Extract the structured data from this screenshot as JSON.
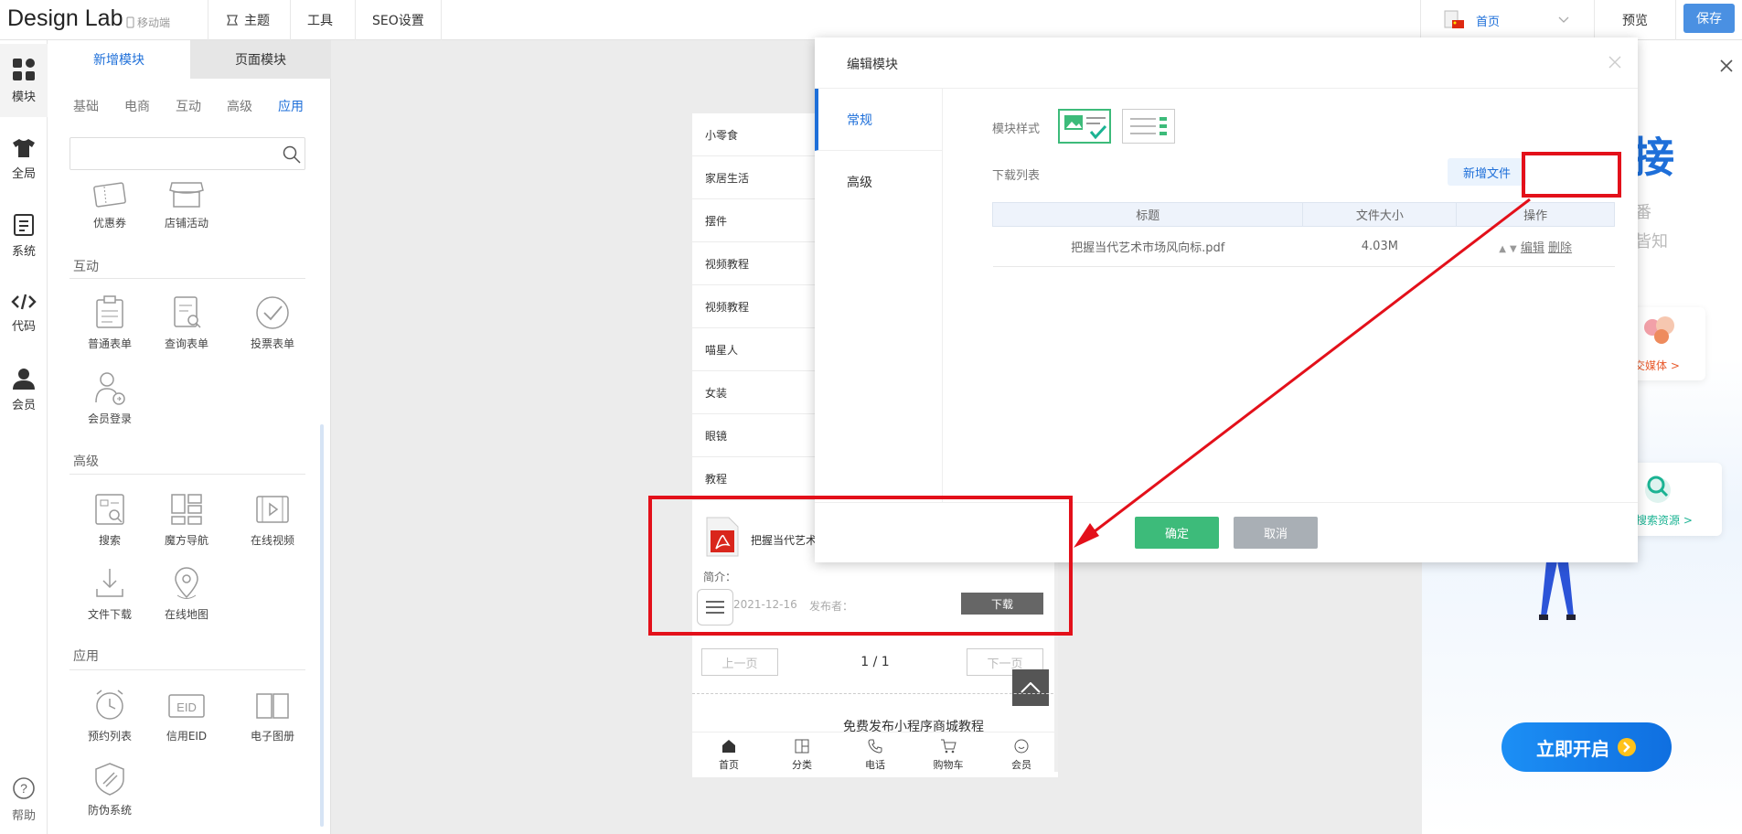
{
  "topbar": {
    "logo": "Design Lab",
    "mobile": "移动端",
    "theme": "主题",
    "tools": "工具",
    "seo": "SEO设置",
    "page_select": "首页",
    "preview": "预览",
    "save": "保存"
  },
  "leftbar": {
    "items": [
      {
        "label": "模块",
        "icon": "grid-icon"
      },
      {
        "label": "全局",
        "icon": "shirt-icon"
      },
      {
        "label": "系统",
        "icon": "document-icon"
      },
      {
        "label": "代码",
        "icon": "code-icon"
      },
      {
        "label": "会员",
        "icon": "user-icon"
      }
    ],
    "help": "帮助"
  },
  "panel": {
    "tab_add": "新增模块",
    "tab_page": "页面模块",
    "subtabs": [
      "基础",
      "电商",
      "互动",
      "高级",
      "应用"
    ],
    "top_modules": [
      "优惠券",
      "店铺活动"
    ],
    "sections": [
      {
        "title": "互动",
        "modules": [
          "普通表单",
          "查询表单",
          "投票表单",
          "会员登录"
        ]
      },
      {
        "title": "高级",
        "modules": [
          "搜索",
          "魔方导航",
          "在线视频",
          "文件下载",
          "在线地图"
        ]
      },
      {
        "title": "应用",
        "modules": [
          "预约列表",
          "信用EID",
          "电子图册",
          "防伪系统"
        ]
      }
    ]
  },
  "phone": {
    "list": [
      "小零食",
      "家居生活",
      "摆件",
      "视频教程",
      "视频教程",
      "喵星人",
      "女装",
      "眼镜",
      "教程"
    ],
    "file_name": "把握当代艺术",
    "intro": "简介：",
    "date": "2021-12-16",
    "publisher": "发布者：",
    "download": "下载",
    "prev": "上一页",
    "page": "1 / 1",
    "next": "下一页",
    "promo_text": "免费发布小程序商城教程",
    "nav": [
      "首页",
      "分类",
      "电话",
      "购物车",
      "会员"
    ]
  },
  "dialog": {
    "title": "编辑模块",
    "side_tabs": [
      "常规",
      "高级"
    ],
    "style_label": "模块样式",
    "list_label": "下载列表",
    "add_file": "新增文件",
    "columns": [
      "标题",
      "文件大小",
      "操作"
    ],
    "rows": [
      {
        "title": "把握当代艺术市场风向标.pdf",
        "size": "4.03M",
        "edit": "编辑",
        "delete": "删除"
      }
    ],
    "confirm": "确定",
    "cancel": "取消"
  },
  "promo": {
    "headline": "接",
    "sub1": "番",
    "sub2": "皆知",
    "social": "社交媒体 >",
    "search": "搜索资源 >",
    "cta": "立即开启"
  },
  "colors": {
    "accent": "#1e6fd9",
    "save": "#4a90e2",
    "confirm": "#3dbb7a",
    "cancel": "#a9afb5",
    "highlight": "#e3101a"
  }
}
